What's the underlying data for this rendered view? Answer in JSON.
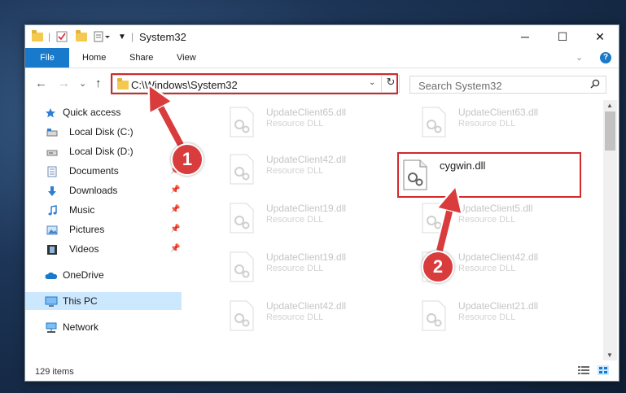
{
  "window": {
    "title": "System32",
    "controls": {
      "minimize": "─",
      "maximize": "☐",
      "close": "✕"
    }
  },
  "ribbon": {
    "tabs": [
      "File",
      "Home",
      "Share",
      "View"
    ],
    "collapse": "⌄",
    "help": "?"
  },
  "navigation": {
    "back": "←",
    "forward": "→",
    "recent": "⌄",
    "up": "↑",
    "address": "C:\\Windows\\System32",
    "address_dropdown": "⌄",
    "refresh": "↻",
    "search_placeholder": "Search System32",
    "search_icon": "search-icon"
  },
  "sidebar": {
    "items": [
      {
        "label": "Quick access",
        "icon": "star-icon",
        "pinned": false
      },
      {
        "label": "Local Disk (C:)",
        "icon": "drive-icon",
        "pinned": false
      },
      {
        "label": "Local Disk (D:)",
        "icon": "drive-icon",
        "pinned": false
      },
      {
        "label": "Documents",
        "icon": "documents-icon",
        "pinned": true
      },
      {
        "label": "Downloads",
        "icon": "download-icon",
        "pinned": true
      },
      {
        "label": "Music",
        "icon": "music-icon",
        "pinned": true
      },
      {
        "label": "Pictures",
        "icon": "pictures-icon",
        "pinned": true
      },
      {
        "label": "Videos",
        "icon": "video-icon",
        "pinned": true
      },
      {
        "label": "OneDrive",
        "icon": "cloud-icon",
        "pinned": false
      },
      {
        "label": "This PC",
        "icon": "computer-icon",
        "pinned": false,
        "selected": true
      },
      {
        "label": "Network",
        "icon": "network-icon",
        "pinned": false
      }
    ],
    "pin_glyph": "📌"
  },
  "files": [
    {
      "name": "UpdateClient65.dll",
      "type": "Resource DLL"
    },
    {
      "name": "UpdateClient63.dll",
      "type": "Resource DLL"
    },
    {
      "name": "UpdateClient42.dll",
      "type": "Resource DLL"
    },
    {
      "name": "cygwin.dll",
      "type": "",
      "highlighted": true
    },
    {
      "name": "UpdateClient19.dll",
      "type": "Resource DLL"
    },
    {
      "name": "UpdateClient5.dll",
      "type": "Resource DLL"
    },
    {
      "name": "UpdateClient19.dll",
      "type": "Resource DLL"
    },
    {
      "name": "UpdateClient42.dll",
      "type": "Resource DLL"
    },
    {
      "name": "UpdateClient42.dll",
      "type": "Resource DLL"
    },
    {
      "name": "UpdateClient21.dll",
      "type": "Resource DLL"
    }
  ],
  "status": {
    "item_count": "129 items"
  },
  "steps": [
    "1",
    "2"
  ],
  "colors": {
    "accent": "#1979ca",
    "highlight": "#d02a2a",
    "selection": "#cce8ff"
  }
}
